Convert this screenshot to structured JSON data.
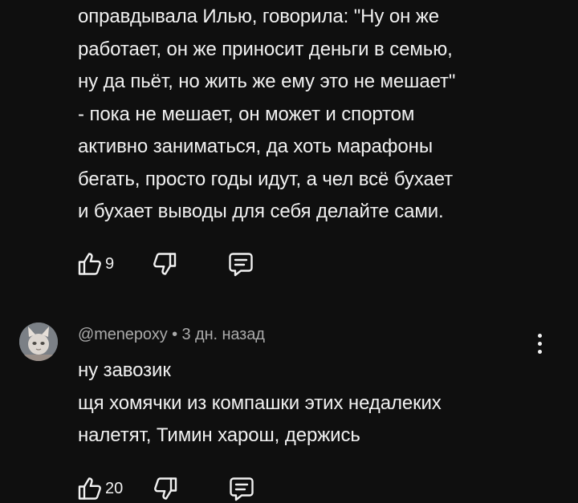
{
  "comments": [
    {
      "text_lines": [
        "оправдывала Илью, говорила: \"Ну он же",
        "работает, он же приносит деньги в семью,",
        "ну да пьёт, но жить же ему это не мешает\"",
        "- пока не мешает, он может и спортом",
        "активно заниматься, да хоть марафоны",
        "бегать, просто годы идут, а чел всё бухает",
        "и бухает выводы для себя делайте сами."
      ],
      "likes": "9"
    },
    {
      "author": "@menepoxy",
      "separator": "•",
      "time": "3 дн. назад",
      "text_lines": [
        "ну завозик",
        "щя хомячки из компашки этих недалеких",
        "налетят, Тимин харош, держись"
      ],
      "likes": "20"
    }
  ],
  "icons": {
    "like": "thumbs-up-icon",
    "dislike": "thumbs-down-icon",
    "reply": "reply-comment-icon",
    "more": "more-vertical-icon"
  }
}
